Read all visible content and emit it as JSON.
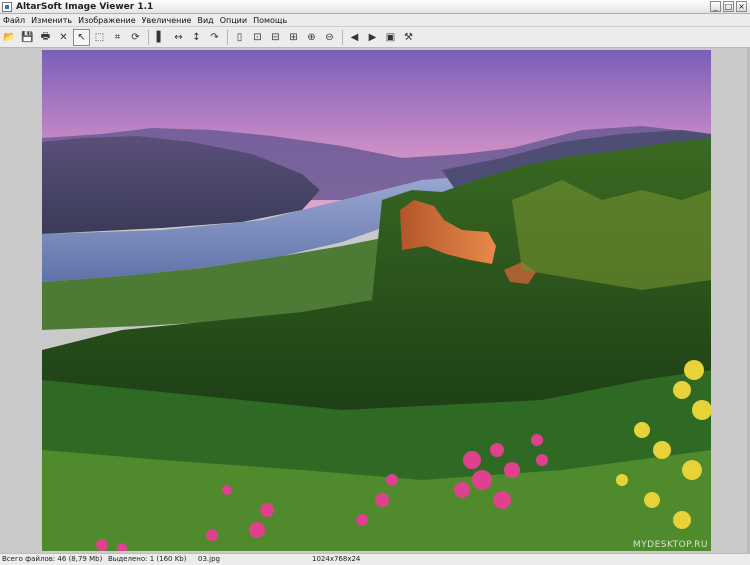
{
  "window": {
    "title": "AltarSoft Image Viewer 1.1",
    "controls": [
      "_",
      "□",
      "×"
    ]
  },
  "menu": [
    {
      "label": "Файл"
    },
    {
      "label": "Изменить"
    },
    {
      "label": "Изображение"
    },
    {
      "label": "Увеличение"
    },
    {
      "label": "Вид"
    },
    {
      "label": "Опции"
    },
    {
      "label": "Помощь"
    }
  ],
  "toolbar": [
    {
      "icon": "open-folder-icon",
      "glyph": "📂"
    },
    {
      "icon": "save-icon",
      "glyph": "💾"
    },
    {
      "icon": "print-icon",
      "glyph": "🖶"
    },
    {
      "icon": "delete-icon",
      "glyph": "✕"
    },
    {
      "icon": "pointer-icon",
      "glyph": "↖",
      "active": true
    },
    {
      "icon": "select-rect-icon",
      "glyph": "⬚"
    },
    {
      "icon": "crop-icon",
      "glyph": "⌗"
    },
    {
      "icon": "rotate-icon",
      "glyph": "⟳"
    },
    {
      "sep": true
    },
    {
      "icon": "contrast-icon",
      "glyph": "▌"
    },
    {
      "icon": "flip-horizontal-icon",
      "glyph": "↔"
    },
    {
      "icon": "flip-vertical-icon",
      "glyph": "↕"
    },
    {
      "icon": "rotate-right-icon",
      "glyph": "↷"
    },
    {
      "sep": true
    },
    {
      "icon": "page-icon",
      "glyph": "▯"
    },
    {
      "icon": "fit-window-icon",
      "glyph": "⊡"
    },
    {
      "icon": "fit-width-icon",
      "glyph": "⊟"
    },
    {
      "icon": "fit-height-icon",
      "glyph": "⊞"
    },
    {
      "icon": "zoom-in-icon",
      "glyph": "⊕"
    },
    {
      "icon": "zoom-out-icon",
      "glyph": "⊖"
    },
    {
      "sep": true
    },
    {
      "icon": "previous-icon",
      "glyph": "◀"
    },
    {
      "icon": "next-icon",
      "glyph": "▶"
    },
    {
      "icon": "slideshow-icon",
      "glyph": "▣"
    },
    {
      "icon": "settings-icon",
      "glyph": "⚒"
    }
  ],
  "status": {
    "total_files": "Всего файлов: 46 (8,79 Mb)",
    "selected": "Выделено: 1 (160 Kb)",
    "filename": "03.jpg",
    "dimensions": "1024x768x24"
  },
  "watermark": "MYDESKTOP.RU",
  "colors": {
    "sky_top": "#7a5fb8",
    "sky_bottom": "#d49ac8",
    "river": "#7d8fbf",
    "cliff": "#d8733a",
    "forest": "#1f4a1c",
    "flowers": "#e0418f",
    "yellow_flowers": "#e7d23a"
  }
}
